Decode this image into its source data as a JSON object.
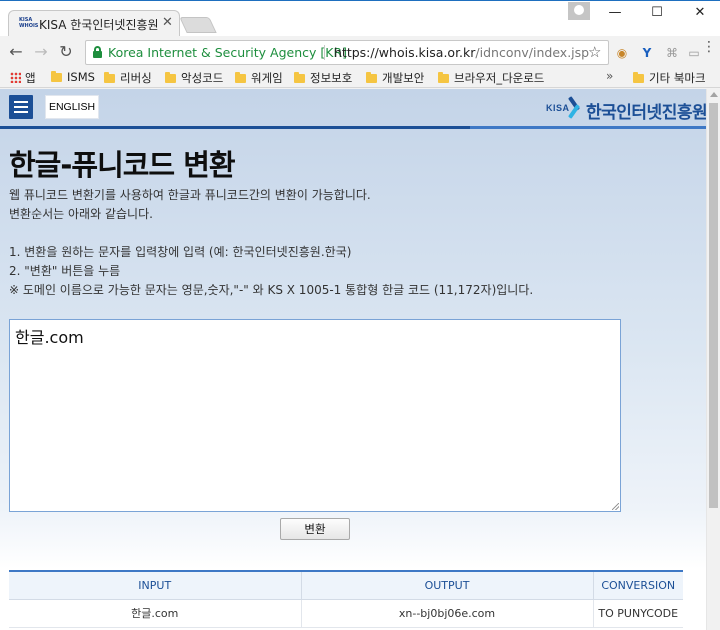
{
  "browser": {
    "tab_title": "KISA 한국인터넷진흥원",
    "tab_favicon_text": "KISA WHOIS",
    "address": {
      "origin": "Korea Internet & Security Agency [KR]",
      "url_host": "https://whois.kisa.or.kr",
      "url_path": "/idnconv/index.jsp"
    },
    "bookmarks": [
      {
        "label": "앱",
        "icon": "apps-grid-icon"
      },
      {
        "label": "ISMS",
        "icon": "folder-icon"
      },
      {
        "label": "리버싱",
        "icon": "folder-icon"
      },
      {
        "label": "악성코드",
        "icon": "folder-icon"
      },
      {
        "label": "워게임",
        "icon": "folder-icon"
      },
      {
        "label": "정보보호",
        "icon": "folder-icon"
      },
      {
        "label": "개발보안",
        "icon": "folder-icon"
      },
      {
        "label": "브라우저_다운로드",
        "icon": "folder-icon"
      },
      {
        "label": "기타 북마크",
        "icon": "folder-icon"
      }
    ],
    "bookmarks_overflow": "»"
  },
  "site": {
    "english_label": "ENGLISH",
    "logo_mark": "KISA",
    "logo_text": "한국인터넷진흥원",
    "brand_color": "#1c4f96"
  },
  "page": {
    "title": "한글-퓨니코드 변환",
    "desc_line1": "웹 퓨니코드 변환기를 사용하여 한글과 퓨니코드간의 변환이 가능합니다.",
    "desc_line2": "변환순서는 아래와 같습니다.",
    "step1": "1. 변환을 원하는 문자를 입력창에 입력 (예: 한국인터넷진흥원.한국)",
    "step2": "2. \"변환\" 버튼을 누름",
    "note": "※ 도메인 이름으로 가능한 문자는 영문,숫자,\"-\" 와 KS X 1005-1 통합형 한글 코드 (11,172자)입니다.",
    "input_value": "한글.com",
    "convert_label": "변환"
  },
  "results": {
    "headers": [
      "INPUT",
      "OUTPUT",
      "CONVERSION"
    ],
    "rows": [
      [
        "한글.com",
        "xn--bj0bj06e.com",
        "TO PUNYCODE"
      ]
    ]
  }
}
